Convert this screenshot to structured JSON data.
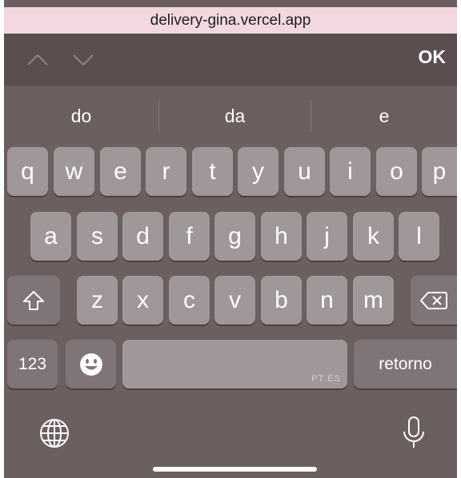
{
  "browser": {
    "url": "delivery-gina.vercel.app"
  },
  "toolbar": {
    "ok_label": "OK"
  },
  "suggestions": [
    "do",
    "da",
    "e"
  ],
  "rows": {
    "row1": [
      "q",
      "w",
      "e",
      "r",
      "t",
      "y",
      "u",
      "i",
      "o",
      "p"
    ],
    "row2": [
      "a",
      "s",
      "d",
      "f",
      "g",
      "h",
      "j",
      "k",
      "l"
    ],
    "row3": [
      "z",
      "x",
      "c",
      "v",
      "b",
      "n",
      "m"
    ]
  },
  "bottom_row": {
    "numbers_label": "123",
    "space_language": "PT ES",
    "return_label": "retorno"
  },
  "icons": {
    "prev": "chevron-up-icon",
    "next": "chevron-down-icon",
    "shift": "shift-icon",
    "delete": "backspace-icon",
    "emoji": "emoji-icon",
    "globe": "globe-icon",
    "mic": "microphone-icon"
  },
  "colors": {
    "url_bar": "#f3d9df",
    "toolbar": "#5a4e4f",
    "keyboard": "#6b5f60",
    "key": "#a09898",
    "function_key": "#7f7576"
  }
}
